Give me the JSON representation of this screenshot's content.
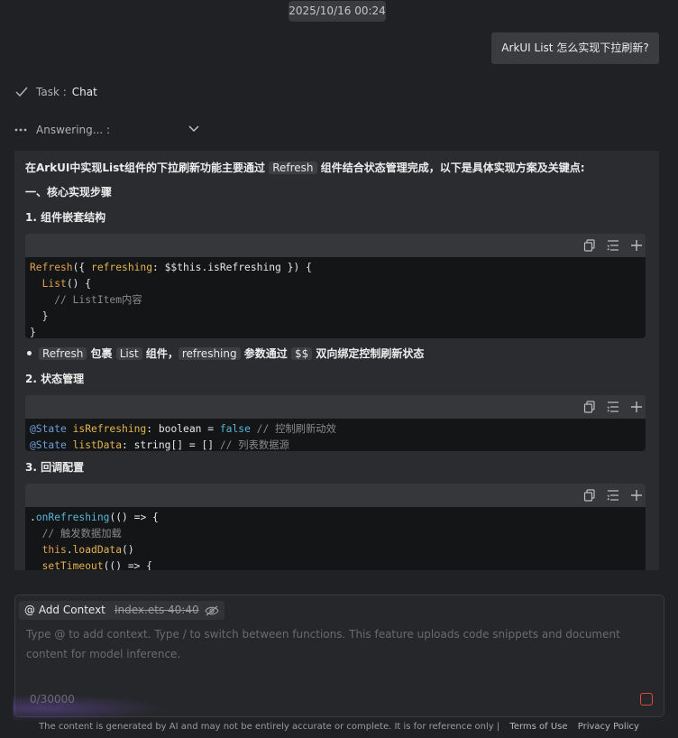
{
  "timestamp": "2025/10/16 00:24",
  "user_message": "ArkUI List 怎么实现下拉刷新?",
  "task": {
    "label": "Task :",
    "value": "Chat"
  },
  "status": {
    "label": "Answering... :"
  },
  "answer": {
    "intro": "在ArkUI中实现List组件的下拉刷新功能主要通过 ",
    "intro_code": "Refresh",
    "intro_rest": " 组件结合状态管理完成，以下是具体实现方案及关键点:",
    "section1": "一、核心实现步骤",
    "step1": "1. 组件嵌套结构",
    "code1": {
      "l1": {
        "a": "Refresh",
        "b": "({ ",
        "c": "refreshing",
        "d": ": $$this.isRefreshing }) {"
      },
      "l2": {
        "a": "  List",
        "b": "() {"
      },
      "l3": "    // ListItem内容",
      "l4": "  }",
      "l5": "}"
    },
    "bullet": {
      "code_a": "Refresh",
      "t1": " 包裹 ",
      "code_b": "List",
      "t2": " 组件，",
      "code_c": "refreshing",
      "t3": " 参数通过 ",
      "code_d": "$$",
      "t4": " 双向绑定控制刷新状态"
    },
    "step2": "2. 状态管理",
    "code2": {
      "l1": {
        "a": "@State",
        "b": " isRefreshing",
        "c": ": boolean = ",
        "d": "false",
        "e": " // 控制刷新动效"
      },
      "l2": {
        "a": "@State",
        "b": " listData",
        "c": ": string[] = [] ",
        "e": "// 列表数据源"
      }
    },
    "step3": "3. 回调配置",
    "code3": {
      "l1": {
        "a": ".",
        "b": "onRefreshing",
        "c": "(() => {"
      },
      "l2": "  // 触发数据加载",
      "l3": {
        "a": "  this",
        "b": ".",
        "c": "loadData",
        "d": "()"
      },
      "l4": {
        "a": "  setTimeout",
        "b": "(() => {"
      }
    }
  },
  "input": {
    "add_context": "@ Add Context",
    "file_chip": "Index.ets  40:40",
    "placeholder": "Type @ to add context. Type / to switch between functions. This feature uploads code snippets and document content for model inference.",
    "counter": "0/30000"
  },
  "footer": {
    "disclaimer": "The content is generated by AI and may not be entirely accurate or complete. It is for reference only  |",
    "terms": "Terms of Use",
    "privacy": "Privacy Policy"
  },
  "colors": {
    "background": "#202124",
    "panel": "#2b2c2f",
    "code_bg": "#141517",
    "stop_red": "#e0483f"
  }
}
